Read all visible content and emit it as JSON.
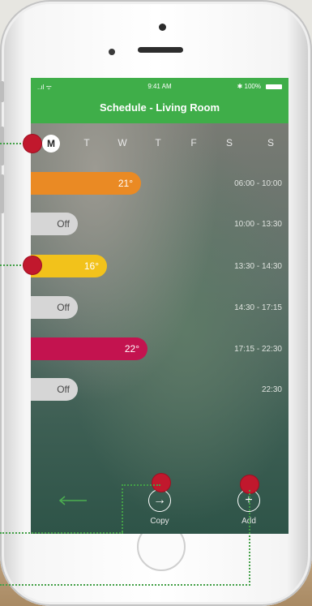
{
  "status_bar": {
    "signal": "..ıl ᯤ",
    "time": "9:41 AM",
    "battery": "✱ 100%"
  },
  "header": {
    "title": "Schedule - Living Room"
  },
  "days": [
    "M",
    "T",
    "W",
    "T",
    "F",
    "S",
    "S"
  ],
  "active_day_index": 0,
  "schedule": [
    {
      "label": "21°",
      "time": "06:00 - 10:00",
      "color": "#ea8a24"
    },
    {
      "label": "Off",
      "time": "10:00 - 13:30",
      "color": "#d6d6d6"
    },
    {
      "label": "16°",
      "time": "13:30 - 14:30",
      "color": "#f2c21b"
    },
    {
      "label": "Off",
      "time": "14:30 - 17:15",
      "color": "#d6d6d6"
    },
    {
      "label": "22°",
      "time": "17:15 - 22:30",
      "color": "#c3134f"
    },
    {
      "label": "Off",
      "time": "22:30",
      "color": "#d6d6d6"
    }
  ],
  "footer": {
    "copy_label": "Copy",
    "add_label": "Add"
  },
  "colors": {
    "header": "#3fae49",
    "marker": "#c1182d",
    "callout_line": "#43a047"
  }
}
